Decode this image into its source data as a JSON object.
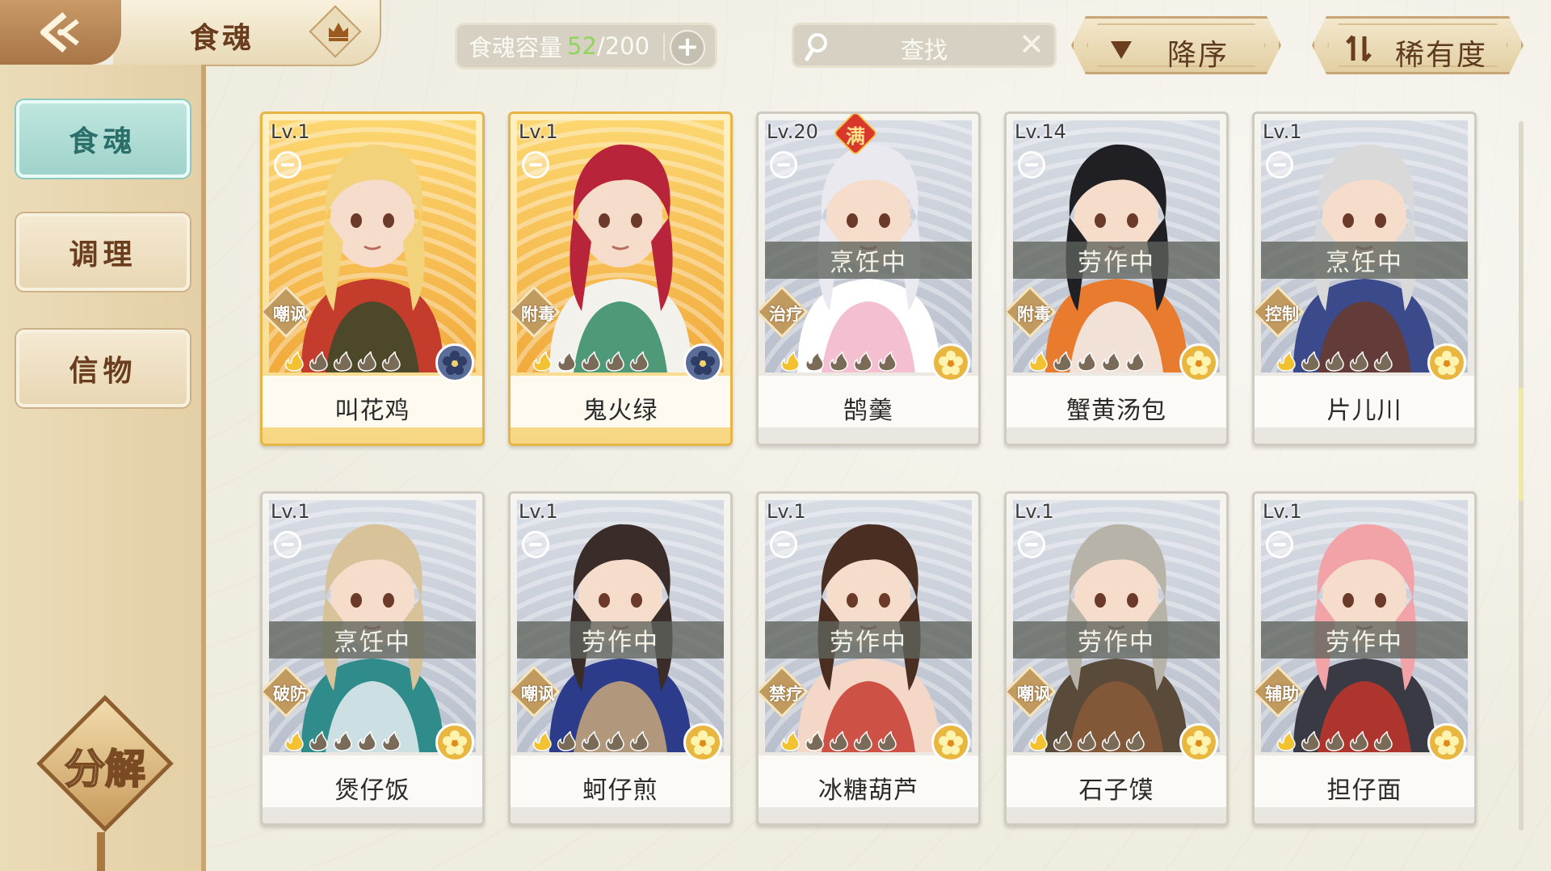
{
  "header": {
    "title": "食魂",
    "capacity_label": "食魂容量",
    "capacity_current": "52",
    "capacity_sep": "/",
    "capacity_max": "200",
    "search_placeholder": "查找",
    "sort_order_label": "降序",
    "sort_key_label": "稀有度"
  },
  "sidebar": {
    "tabs": [
      {
        "label": "食魂",
        "active": true
      },
      {
        "label": "调理",
        "active": false
      },
      {
        "label": "信物",
        "active": false
      }
    ],
    "decompose_label": "分解"
  },
  "cards": [
    {
      "level": "Lv.1",
      "name": "叫花鸡",
      "role": "嘲讽",
      "status": "",
      "full": "",
      "style": "gold",
      "element": "blue",
      "filled_flames": 1,
      "palette": [
        "#f2d27a",
        "#3a4a2a",
        "#c43d2c"
      ]
    },
    {
      "level": "Lv.1",
      "name": "鬼火绿",
      "role": "附毒",
      "status": "",
      "full": "",
      "style": "gold",
      "element": "blue",
      "filled_flames": 1,
      "palette": [
        "#b8253a",
        "#2f8a64",
        "#f3f1ec"
      ]
    },
    {
      "level": "Lv.20",
      "name": "鹄羹",
      "role": "治疗",
      "status": "烹饪中",
      "full": "满",
      "style": "silver",
      "element": "gold",
      "filled_flames": 1,
      "palette": [
        "#e9e9ef",
        "#f2b4c8",
        "#ffffff"
      ]
    },
    {
      "level": "Lv.14",
      "name": "蟹黄汤包",
      "role": "附毒",
      "status": "劳作中",
      "full": "",
      "style": "silver",
      "element": "gold",
      "filled_flames": 1,
      "palette": [
        "#1f1f24",
        "#f3f3f3",
        "#e87b2e"
      ]
    },
    {
      "level": "Lv.1",
      "name": "片儿川",
      "role": "控制",
      "status": "烹饪中",
      "full": "",
      "style": "silver",
      "element": "gold",
      "filled_flames": 1,
      "palette": [
        "#d9d9d9",
        "#6b3a2a",
        "#3b4a8a"
      ]
    },
    {
      "level": "Lv.1",
      "name": "煲仔饭",
      "role": "破防",
      "status": "烹饪中",
      "full": "",
      "style": "silver",
      "element": "gold",
      "filled_flames": 1,
      "palette": [
        "#d7c29a",
        "#e7eef3",
        "#2f8c8a"
      ]
    },
    {
      "level": "Lv.1",
      "name": "蚵仔煎",
      "role": "嘲讽",
      "status": "劳作中",
      "full": "",
      "style": "silver",
      "element": "gold",
      "filled_flames": 1,
      "palette": [
        "#3a2c28",
        "#c9a97a",
        "#2c3b8a"
      ]
    },
    {
      "level": "Lv.1",
      "name": "冰糖葫芦",
      "role": "禁疗",
      "status": "劳作中",
      "full": "",
      "style": "silver",
      "element": "gold",
      "filled_flames": 1,
      "palette": [
        "#4a2e22",
        "#c73a2f",
        "#f5d7c7"
      ]
    },
    {
      "level": "Lv.1",
      "name": "石子馍",
      "role": "嘲讽",
      "status": "劳作中",
      "full": "",
      "style": "silver",
      "element": "gold",
      "filled_flames": 1,
      "palette": [
        "#b8b3a8",
        "#8a5a3a",
        "#5a4a3a"
      ]
    },
    {
      "level": "Lv.1",
      "name": "担仔面",
      "role": "辅助",
      "status": "劳作中",
      "full": "",
      "style": "silver",
      "element": "gold",
      "filled_flames": 1,
      "palette": [
        "#f2a3a8",
        "#c3352a",
        "#3a3a44"
      ]
    }
  ]
}
